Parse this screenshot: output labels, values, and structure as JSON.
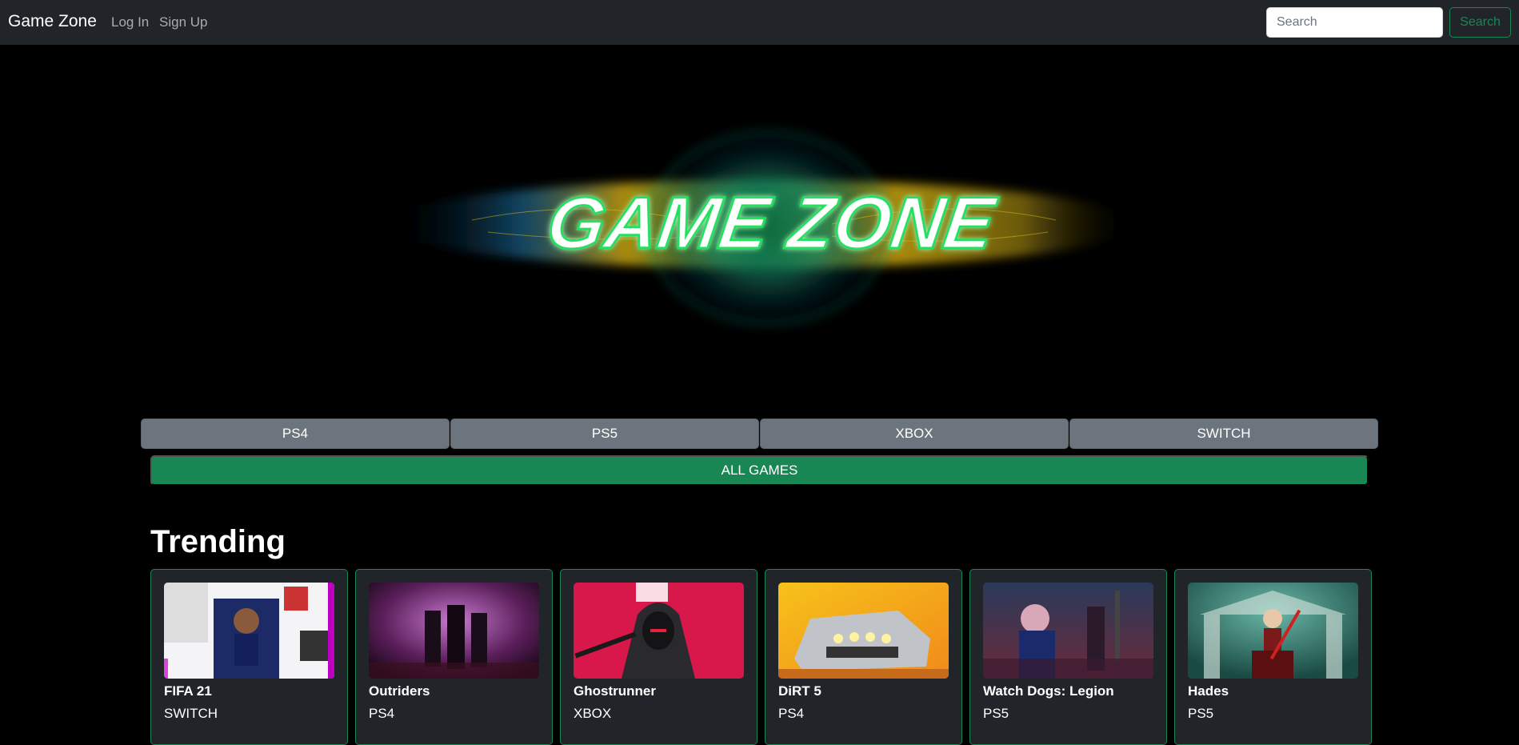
{
  "navbar": {
    "brand": "Game Zone",
    "links": [
      "Log In",
      "Sign Up"
    ],
    "search_placeholder": "Search",
    "search_button": "Search"
  },
  "hero": {
    "logo_text": "GAME ZONE"
  },
  "platforms": [
    "PS4",
    "PS5",
    "XBOX",
    "SWITCH"
  ],
  "all_games_label": "ALL GAMES",
  "trending": {
    "title": "Trending",
    "games": [
      {
        "title": "FIFA 21",
        "platform": "SWITCH"
      },
      {
        "title": "Outriders",
        "platform": "PS4"
      },
      {
        "title": "Ghostrunner",
        "platform": "XBOX"
      },
      {
        "title": "DiRT 5",
        "platform": "PS4"
      },
      {
        "title": "Watch Dogs: Legion",
        "platform": "PS5"
      },
      {
        "title": "Hades",
        "platform": "PS5"
      }
    ]
  },
  "colors": {
    "navbar_bg": "#212529",
    "accent_green": "#198754",
    "platform_button_bg": "#6c757d",
    "card_bg": "#212529"
  }
}
